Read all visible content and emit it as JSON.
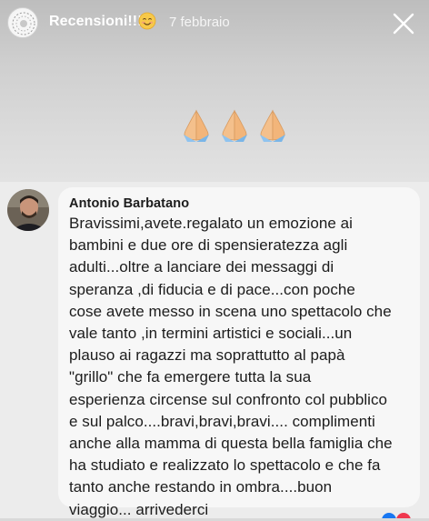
{
  "story": {
    "username": "Recensioni!!!",
    "username_emoji": "smiling-face-emoji",
    "date": "7 febbraio",
    "close_icon": "close-x-icon",
    "sticker": "folded-hands-emoji-x3"
  },
  "comment": {
    "author": "Antonio Barbatano",
    "lines": [
      "Bravissimi,avete.regalato un emozione ai",
      "bambini e due ore di spensieratezza agli",
      "adulti...oltre a lanciare dei messaggi di",
      "speranza ,di fiducia e di pace...con poche",
      "cose avete messo in scena uno spettacolo che",
      "vale tanto ,in termini artistici e sociali...un",
      "plauso ai ragazzi ma soprattutto al papà",
      "\"grillo\" che fa emergere tutta la sua",
      "esperienza circense sul confronto col pubblico",
      "e sul palco....bravi,bravi,bravi.... complimenti",
      "anche alla mamma di questa bella famiglia che",
      "ha studiato e realizzato lo spettacolo e che fa",
      "tanto anche restando in ombra....buon",
      "viaggio... arrivederci"
    ]
  },
  "colors": {
    "bubble": "#f7f7f7",
    "comment_area": "#ececec",
    "text": "#1c1c1c"
  }
}
